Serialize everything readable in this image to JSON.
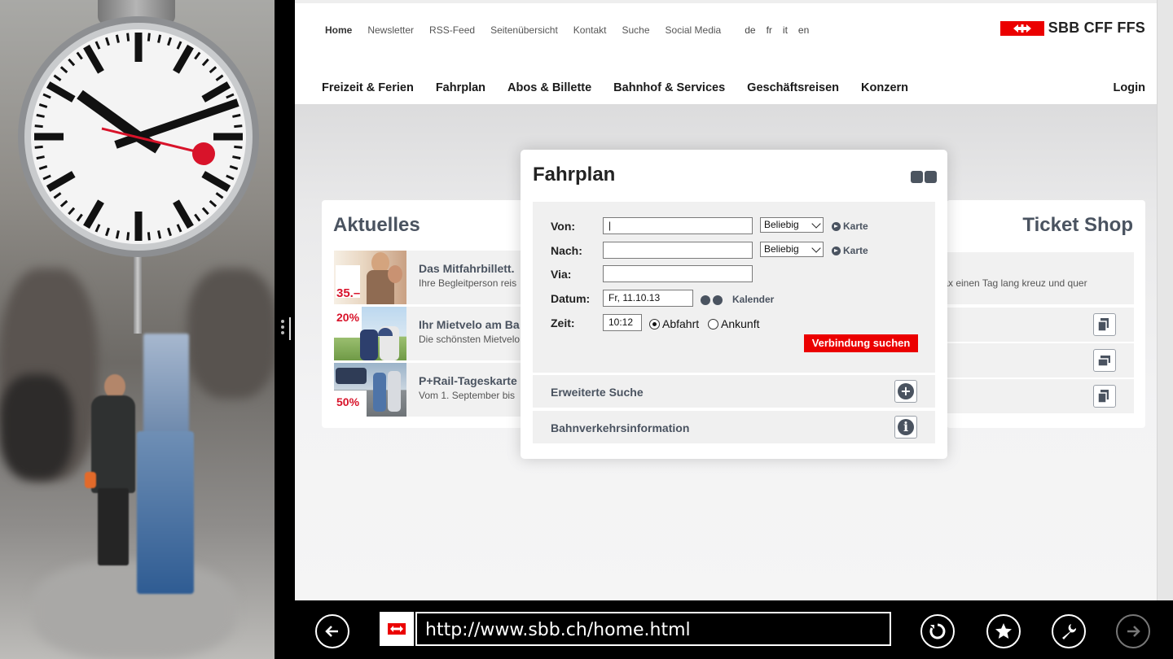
{
  "browser": {
    "url": "http://www.sbb.ch/home.html"
  },
  "header": {
    "utility_links": [
      "Home",
      "Newsletter",
      "RSS-Feed",
      "Seitenübersicht",
      "Kontakt",
      "Suche",
      "Social Media"
    ],
    "languages": [
      "de",
      "fr",
      "it",
      "en"
    ],
    "logo_text": "SBB CFF FFS",
    "main_nav": [
      "Freizeit & Ferien",
      "Fahrplan",
      "Abos & Billette",
      "Bahnhof & Services",
      "Geschäftsreisen",
      "Konzern"
    ],
    "login": "Login"
  },
  "aktuelles": {
    "title": "Aktuelles",
    "items": [
      {
        "title": "Das Mitfahrbillett.",
        "sub": "Ihre Begleitperson reis",
        "badge": "35.–"
      },
      {
        "title": "Ihr Mietvelo am Ba",
        "sub": "Die schönsten Mietvelo",
        "badge": "20%"
      },
      {
        "title": "P+Rail-Tageskarte",
        "sub": "Vom 1. September bis",
        "badge": "50%"
      }
    ]
  },
  "ticket_shop": {
    "title": "Ticket Shop",
    "text": "tax einen Tag lang kreuz und quer"
  },
  "fahrplan": {
    "title": "Fahrplan",
    "von_label": "Von:",
    "nach_label": "Nach:",
    "via_label": "Via:",
    "datum_label": "Datum:",
    "zeit_label": "Zeit:",
    "von_value": "|",
    "nach_value": "",
    "via_value": "",
    "von_select": "Beliebig",
    "nach_select": "Beliebig",
    "karte": "Karte",
    "datum_value": "Fr, 11.10.13",
    "kalender": "Kalender",
    "zeit_value": "10:12",
    "abfahrt": "Abfahrt",
    "ankunft": "Ankunft",
    "search_button": "Verbindung suchen",
    "advanced": "Erweiterte Suche",
    "traffic_info": "Bahnverkehrsinformation"
  },
  "colors": {
    "sbb_red": "#eb0000",
    "text_gray": "#4a5360"
  }
}
